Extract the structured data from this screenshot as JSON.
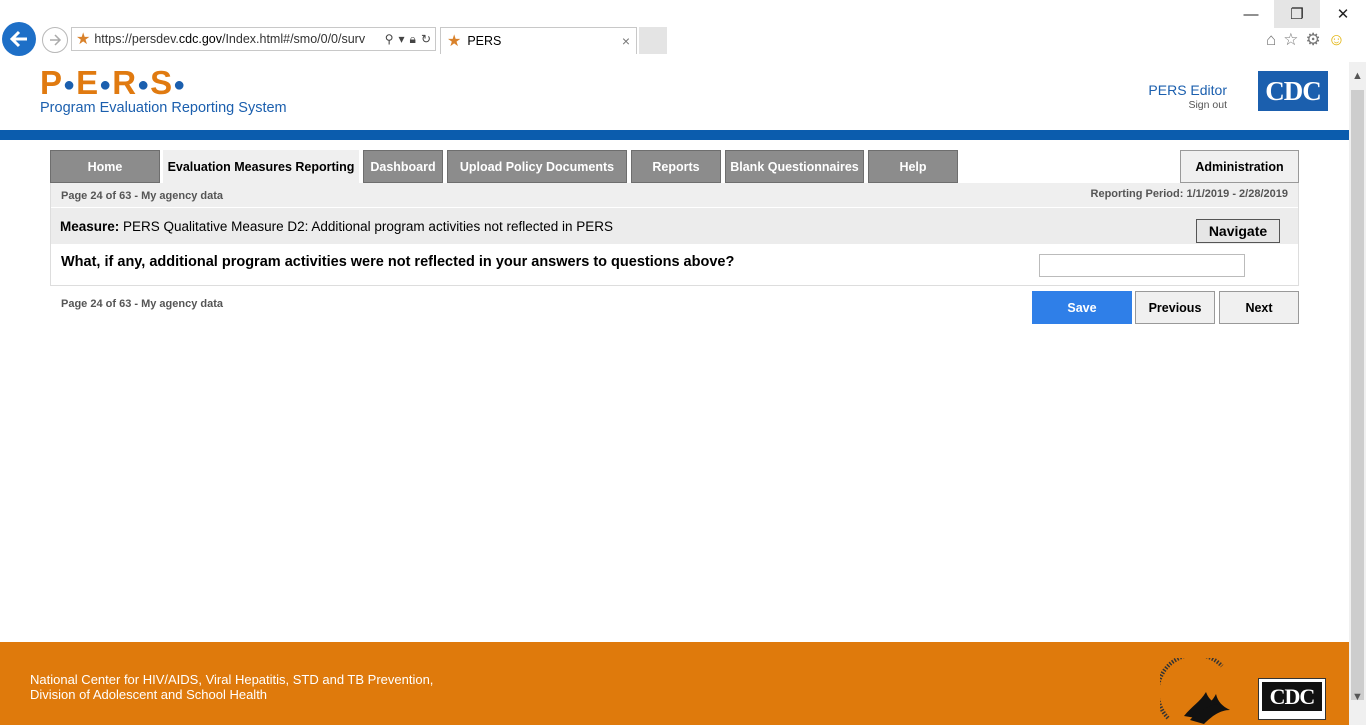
{
  "browser": {
    "url_prefix": "https://persdev.",
    "url_domain": "cdc.gov",
    "url_rest": "/Index.html#/smo/0/0/surv",
    "tab_title": "PERS",
    "tab_close": "×",
    "win_min": "—",
    "win_max": "❐",
    "win_close": "✕"
  },
  "header": {
    "logo_letters": [
      "P",
      "E",
      "R",
      "S"
    ],
    "subtitle": "Program Evaluation Reporting System",
    "user_name": "PERS Editor",
    "sign_out": "Sign out",
    "cdc_logo": "CDC"
  },
  "nav": {
    "items": [
      {
        "label": "Home",
        "active": false
      },
      {
        "label": "Evaluation Measures Reporting",
        "active": true
      },
      {
        "label": "Dashboard",
        "active": false
      },
      {
        "label": "Upload Policy Documents",
        "active": false
      },
      {
        "label": "Reports",
        "active": false
      },
      {
        "label": "Blank Questionnaires",
        "active": false
      },
      {
        "label": "Help",
        "active": false
      }
    ],
    "admin_label": "Administration"
  },
  "page_info": {
    "page_text": "Page 24 of 63 - My agency data",
    "reporting_period": "Reporting Period: 1/1/2019 - 2/28/2019"
  },
  "measure": {
    "label": "Measure:",
    "text": " PERS Qualitative Measure D2: Additional program activities not reflected in PERS",
    "navigate_label": "Navigate"
  },
  "question": {
    "text": "What, if any, additional program activities were not reflected in your answers to questions above?",
    "answer_value": ""
  },
  "actions": {
    "save": "Save",
    "previous": "Previous",
    "next": "Next"
  },
  "footer": {
    "line1": "National Center for HIV/AIDS, Viral Hepatitis, STD and TB Prevention,",
    "line2": "Division of Adolescent and School Health",
    "cdc_logo": "CDC"
  },
  "colors": {
    "brand_orange": "#df7a0c",
    "brand_blue": "#0b5cad",
    "save_blue": "#2f7fe8",
    "nav_gray": "#8c8c8c"
  }
}
